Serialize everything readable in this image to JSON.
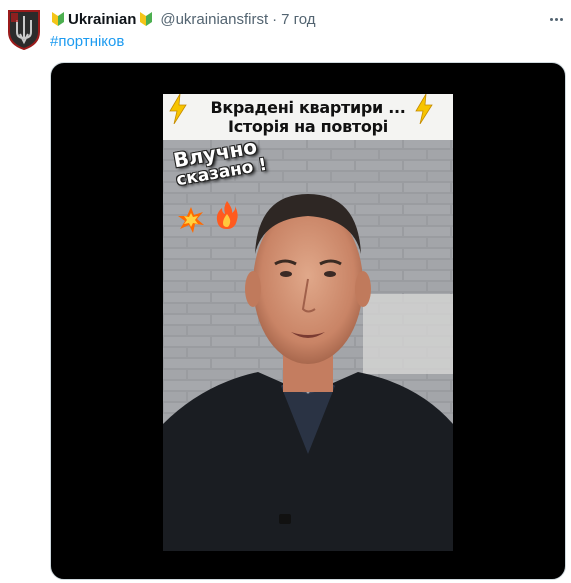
{
  "tweet": {
    "display_name": "Ukrainian",
    "handle": "@ukrainiansfirst",
    "separator": "·",
    "timestamp": "7 год",
    "hashtag": "#портніков"
  },
  "video": {
    "title_line1": "Вкрадені квартири ...",
    "title_line2": "Історія на повторі",
    "caption_line1": "Влучно",
    "caption_line2": "сказано !",
    "emojis": [
      "lightning-icon",
      "collision-icon",
      "fire-icon"
    ]
  },
  "colors": {
    "hashtag": "#1d9bf0",
    "secondary_text": "#536471",
    "media_background": "#000000",
    "badge_green": "#4caf50",
    "badge_yellow": "#f5c518",
    "title_band": "#f4f4f2"
  }
}
